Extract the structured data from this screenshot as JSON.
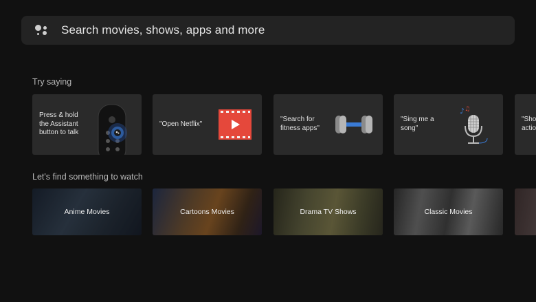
{
  "search": {
    "placeholder": "Search movies, shows, apps and more",
    "icon": "google-assistant-icon"
  },
  "try_saying": {
    "heading": "Try saying",
    "cards": [
      {
        "lines": [
          "Press & hold",
          "the Assistant",
          "button to talk"
        ],
        "icon": "remote-control-icon"
      },
      {
        "lines": [
          "\"Open Netflix\""
        ],
        "icon": "video-play-icon"
      },
      {
        "lines": [
          "\"Search for",
          "fitness apps\""
        ],
        "icon": "dumbbell-icon"
      },
      {
        "lines": [
          "\"Sing me a",
          "song\""
        ],
        "icon": "microphone-icon"
      },
      {
        "lines": [
          "\"Show",
          "actio"
        ],
        "icon": ""
      }
    ]
  },
  "watch": {
    "heading": "Let's find something to watch",
    "tiles": [
      {
        "label": "Anime Movies"
      },
      {
        "label": "Cartoons Movies"
      },
      {
        "label": "Drama TV Shows"
      },
      {
        "label": "Classic Movies"
      }
    ]
  },
  "colors": {
    "background": "#111111",
    "card": "#2a2a2a",
    "search_bar": "#232323",
    "accent_red": "#e5483b",
    "accent_blue": "#3a7bd5"
  }
}
